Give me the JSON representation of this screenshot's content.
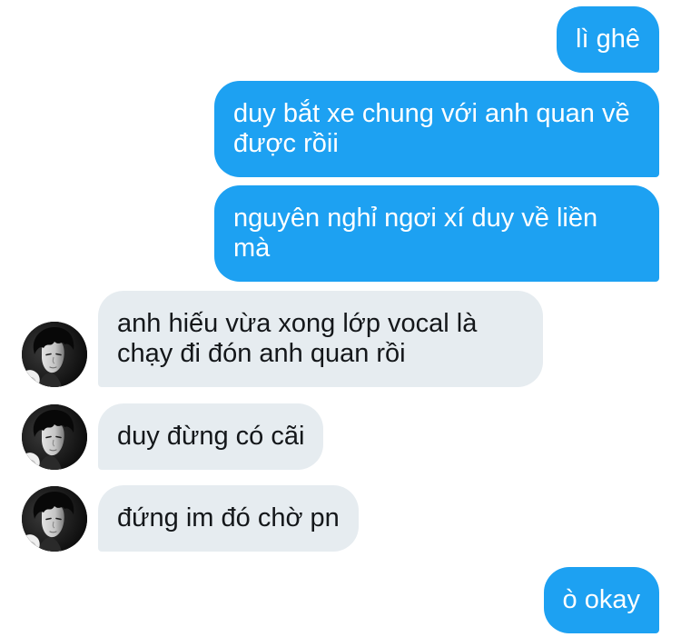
{
  "colors": {
    "background": "#FFFFFF",
    "sent_bubble": "#1DA1F2",
    "sent_text": "#FFFFFF",
    "received_bubble": "#E6ECF0",
    "received_text": "#14171A"
  },
  "messages": [
    {
      "from_me": true,
      "text": "lì ghê"
    },
    {
      "from_me": true,
      "text": "duy bắt xe chung với anh quan về được rồii"
    },
    {
      "from_me": true,
      "text": "nguyên nghỉ ngơi xí duy về liền mà"
    },
    {
      "from_me": false,
      "text": "anh hiếu vừa xong lớp vocal là chạy đi đón anh quan rồi",
      "avatar_icon": "user-photo-avatar"
    },
    {
      "from_me": false,
      "text": "duy đừng có cãi",
      "avatar_icon": "user-photo-avatar"
    },
    {
      "from_me": false,
      "text": "đứng im đó chờ pn",
      "avatar_icon": "user-photo-avatar"
    },
    {
      "from_me": true,
      "text": "ò okay"
    }
  ]
}
